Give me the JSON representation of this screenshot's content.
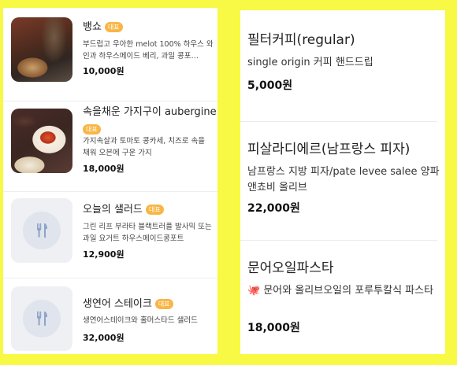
{
  "left_menu": [
    {
      "name": "뱅쇼",
      "badge": "대표",
      "desc": "부드럽고 우아한 melot 100% 하우스 와인과 하우스메이드 베리, 과일 콩포…",
      "price": "10,000원",
      "image": "mulled-wine-photo"
    },
    {
      "name": "속을채운 가지구이 aubergine",
      "badge": "대표",
      "desc": "가지속살과 토마토 콩카세, 치즈로 속을 채워 오븐에 구운 가지",
      "price": "18,000원",
      "image": "stuffed-eggplant-photo"
    },
    {
      "name": "오늘의 샐러드",
      "badge": "대표",
      "desc": "그린 리프 부라타 블랙트러플 발사믹 또는 과일 요거트 하우스메이드콩포트",
      "price": "12,900원",
      "image": "utensils-icon"
    },
    {
      "name": "생연어 스테이크",
      "badge": "대표",
      "desc": "생연어스테이크와 홀머스타드 샐러드",
      "price": "32,000원",
      "image": "utensils-icon"
    }
  ],
  "right_menu": [
    {
      "name": "필터커피(regular)",
      "desc": "single origin 커피 핸드드립",
      "price": "5,000원"
    },
    {
      "name": "피살라디에르(남프랑스 피자)",
      "desc": "남프랑스 지방 피자/pate levee salee 양파 앤쵸비 올리브",
      "price": "22,000원"
    },
    {
      "name": "문어오일파스타",
      "desc": "🐙 문어와 올리브오일의 포루투칼식 파스타",
      "price": "18,000원"
    }
  ],
  "colors": {
    "background": "#f7f944",
    "badge": "#f8b645"
  }
}
